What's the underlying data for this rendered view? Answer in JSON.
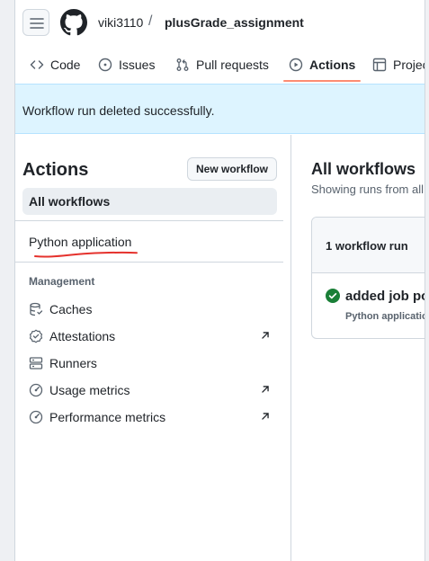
{
  "header": {
    "owner": "viki3110",
    "separator": "/",
    "repo": "plusGrade_assignment"
  },
  "tabs": [
    {
      "label": "Code",
      "icon": "code-icon",
      "active": false
    },
    {
      "label": "Issues",
      "icon": "issue-opened-icon",
      "active": false
    },
    {
      "label": "Pull requests",
      "icon": "git-pull-request-icon",
      "active": false
    },
    {
      "label": "Actions",
      "icon": "play-icon",
      "active": true
    },
    {
      "label": "Projects",
      "icon": "table-icon",
      "active": false
    }
  ],
  "flash": {
    "message": "Workflow run deleted successfully."
  },
  "sidebar": {
    "title": "Actions",
    "new_workflow_label": "New workflow",
    "all_workflows_label": "All workflows",
    "workflows": [
      {
        "label": "Python application"
      }
    ],
    "management_heading": "Management",
    "management_items": [
      {
        "label": "Caches",
        "icon": "database-icon",
        "external": false
      },
      {
        "label": "Attestations",
        "icon": "verified-icon",
        "external": true
      },
      {
        "label": "Runners",
        "icon": "server-icon",
        "external": false
      },
      {
        "label": "Usage metrics",
        "icon": "meter-icon",
        "external": true
      },
      {
        "label": "Performance metrics",
        "icon": "meter-icon",
        "external": true
      }
    ]
  },
  "main": {
    "title": "All workflows",
    "subtitle": "Showing runs from all workflows",
    "runs_count": "1 workflow run",
    "run": {
      "title": "added job possibilities",
      "workflow": "Python application",
      "status": "success"
    }
  },
  "colors": {
    "accent": "#0969da",
    "active_tab_underline": "#fd8c73",
    "flash_bg": "#ddf4ff",
    "success": "#1a7f37",
    "annotation": "#e5322d"
  }
}
